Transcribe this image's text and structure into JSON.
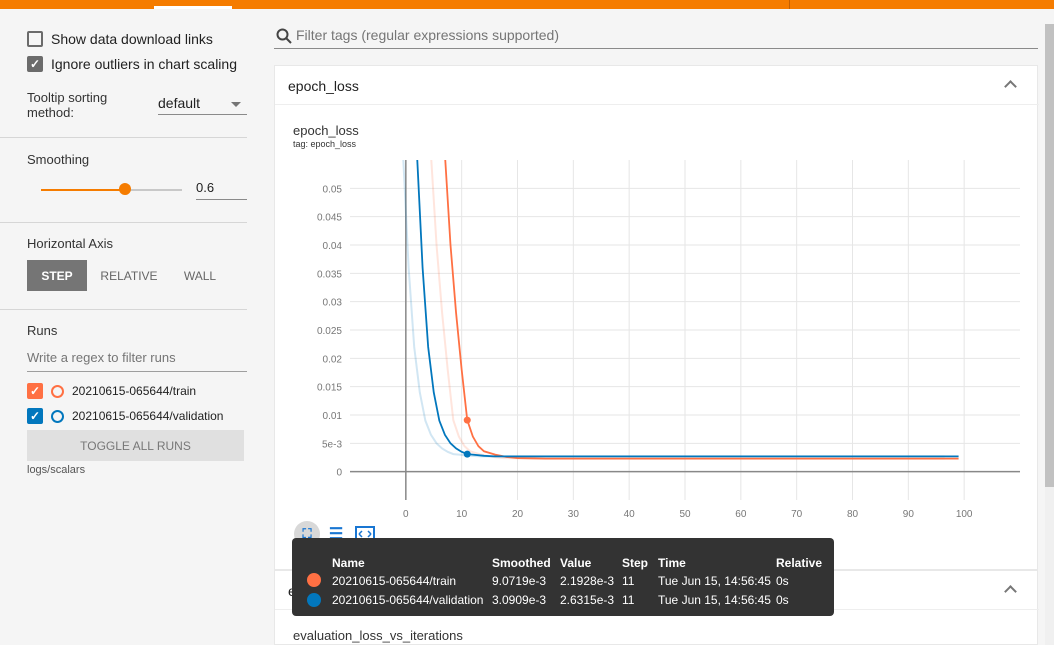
{
  "sidebar": {
    "show_download_links": "Show data download links",
    "ignore_outliers": "Ignore outliers in chart scaling",
    "tooltip_sorting_label": "Tooltip sorting method:",
    "tooltip_sorting_value": "default",
    "smoothing_label": "Smoothing",
    "smoothing_value": "0.6",
    "smoothing_fraction": 0.6,
    "horizontal_axis_label": "Horizontal Axis",
    "axis_options": [
      "STEP",
      "RELATIVE",
      "WALL"
    ],
    "axis_selected": "STEP",
    "runs_label": "Runs",
    "runs_filter_placeholder": "Write a regex to filter runs",
    "runs": [
      {
        "name": "20210615-065644/train",
        "color": "#ff7043",
        "checked": true
      },
      {
        "name": "20210615-065644/validation",
        "color": "#0277bd",
        "checked": true
      }
    ],
    "toggle_all_runs": "TOGGLE ALL RUNS",
    "logdir": "logs/scalars"
  },
  "search": {
    "placeholder": "Filter tags (regular expressions supported)"
  },
  "cards": [
    {
      "title": "epoch_loss"
    },
    {
      "title": "evaluation_loss_vs_iterations"
    }
  ],
  "plot": {
    "title": "epoch_loss",
    "tag": "tag: epoch_loss"
  },
  "chart_data": {
    "type": "line",
    "title": "epoch_loss",
    "xlim": [
      -10,
      110
    ],
    "ylim": [
      -0.005,
      0.055
    ],
    "x_ticks": [
      0,
      10,
      20,
      30,
      40,
      50,
      60,
      70,
      80,
      90,
      100
    ],
    "y_ticks": [
      0,
      0.005,
      0.01,
      0.015,
      0.02,
      0.025,
      0.03,
      0.035,
      0.04,
      0.045,
      0.05
    ],
    "y_tick_labels": [
      "0",
      "5e-3",
      "0.01",
      "0.015",
      "0.02",
      "0.025",
      "0.03",
      "0.035",
      "0.04",
      "0.045",
      "0.05"
    ],
    "x_tick_labels": [
      "0",
      "10",
      "20",
      "30",
      "40",
      "50",
      "60",
      "70",
      "80",
      "90",
      "100"
    ],
    "grid": true,
    "series": [
      {
        "name": "20210615-065644/train",
        "color": "#ff7043",
        "x": [
          7,
          8,
          9,
          10,
          11,
          12,
          13,
          14,
          16,
          18,
          20,
          25,
          30,
          40,
          60,
          80,
          99
        ],
        "y": [
          0.056,
          0.04,
          0.028,
          0.018,
          0.0091,
          0.0062,
          0.0045,
          0.0036,
          0.003,
          0.0026,
          0.0024,
          0.0023,
          0.0023,
          0.0023,
          0.0023,
          0.0023,
          0.0023
        ]
      },
      {
        "name": "20210615-065644/validation",
        "color": "#0277bd",
        "x": [
          2,
          3,
          4,
          5,
          6,
          7,
          8,
          9,
          10,
          11,
          12,
          14,
          16,
          20,
          30,
          40,
          60,
          80,
          99
        ],
        "y": [
          0.056,
          0.036,
          0.022,
          0.014,
          0.009,
          0.0065,
          0.005,
          0.0041,
          0.0035,
          0.0031,
          0.003,
          0.0028,
          0.0027,
          0.0027,
          0.0027,
          0.0027,
          0.0027,
          0.0027,
          0.0027
        ]
      }
    ]
  },
  "tooltip": {
    "headers": [
      "Name",
      "Smoothed",
      "Value",
      "Step",
      "Time",
      "Relative"
    ],
    "rows": [
      {
        "color": "#ff7043",
        "name": "20210615-065644/train",
        "smoothed": "9.0719e-3",
        "value": "2.1928e-3",
        "step": "11",
        "time": "Tue Jun 15, 14:56:45",
        "relative": "0s"
      },
      {
        "color": "#0277bd",
        "name": "20210615-065644/validation",
        "smoothed": "3.0909e-3",
        "value": "2.6315e-3",
        "step": "11",
        "time": "Tue Jun 15, 14:56:45",
        "relative": "0s"
      }
    ]
  },
  "plot_icons": [
    "fit-domain-icon",
    "toggle-log-scale-icon",
    "expand-icon"
  ]
}
